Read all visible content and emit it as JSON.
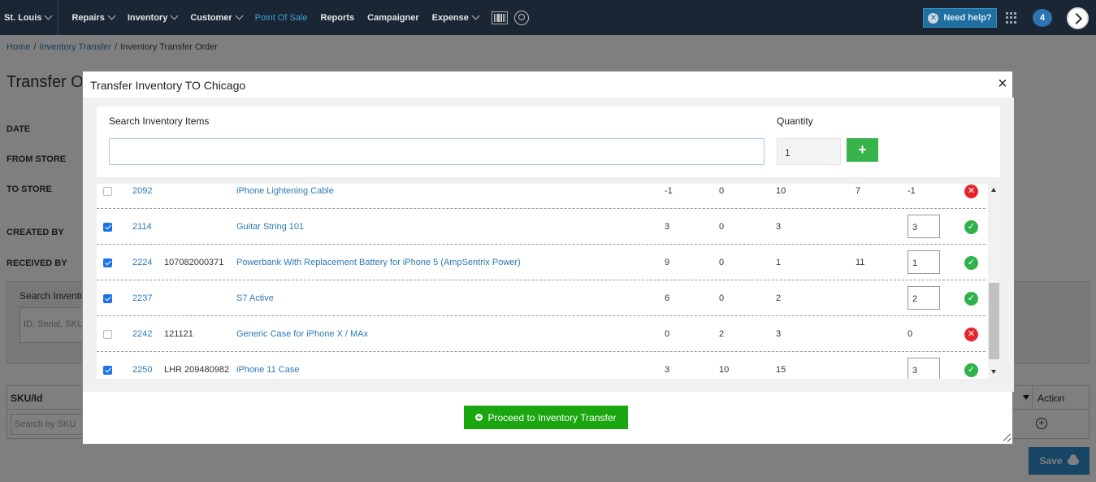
{
  "nav": {
    "items": [
      {
        "label": "St. Louis",
        "dropdown": true
      },
      {
        "label": "Repairs",
        "dropdown": true
      },
      {
        "label": "Inventory",
        "dropdown": true
      },
      {
        "label": "Customer",
        "dropdown": true
      },
      {
        "label": "Point Of Sale",
        "dropdown": false,
        "active": true
      },
      {
        "label": "Reports",
        "dropdown": false
      },
      {
        "label": "Campaigner",
        "dropdown": false
      },
      {
        "label": "Expense",
        "dropdown": true
      }
    ],
    "help_label": "Need help?",
    "notification_count": "4"
  },
  "breadcrumb": {
    "home": "Home",
    "sep": "/",
    "transfer": "Inventory Transfer",
    "current": "Inventory Transfer Order"
  },
  "page": {
    "title": "Transfer O",
    "labels": {
      "date": "DATE",
      "from_store": "FROM STORE",
      "to_store": "TO STORE",
      "created_by": "CREATED BY",
      "received_by": "RECEIVED BY"
    },
    "search_label": "Search Invento",
    "search_placeholder": "ID, Serial, SKU",
    "table": {
      "sku_header": "SKU/Id",
      "action_header": "Action",
      "sku_placeholder": "Search by SKU"
    },
    "save_label": "Save"
  },
  "modal": {
    "title": "Transfer Inventory TO Chicago",
    "close": "×",
    "search_label": "Search Inventory Items",
    "search_value": "",
    "quantity_label": "Quantity",
    "quantity_value": "1",
    "add_label": "+",
    "proceed_label": "Proceed to Inventory Transfer",
    "rows": [
      {
        "checked": false,
        "id": "2092",
        "serial": "",
        "name": "iPhone Lightening Cable",
        "n1": "-1",
        "n2": "0",
        "n3": "10",
        "n4": "7",
        "qty": "-1",
        "qty_input": false,
        "status": "bad"
      },
      {
        "checked": true,
        "id": "2114",
        "serial": "",
        "name": "Guitar String 101",
        "n1": "3",
        "n2": "0",
        "n3": "3",
        "n4": "",
        "qty": "3",
        "qty_input": true,
        "status": "ok"
      },
      {
        "checked": true,
        "id": "2224",
        "serial": "107082000371",
        "name": "Powerbank With Replacement Battery for iPhone 5 (AmpSentrix Power)",
        "n1": "9",
        "n2": "0",
        "n3": "1",
        "n4": "11",
        "qty": "1",
        "qty_input": true,
        "status": "ok"
      },
      {
        "checked": true,
        "id": "2237",
        "serial": "",
        "name": "S7 Active",
        "n1": "6",
        "n2": "0",
        "n3": "2",
        "n4": "",
        "qty": "2",
        "qty_input": true,
        "status": "ok"
      },
      {
        "checked": false,
        "id": "2242",
        "serial": "121121",
        "name": "Generic Case for iPhone X / MAx",
        "n1": "0",
        "n2": "2",
        "n3": "3",
        "n4": "",
        "qty": "0",
        "qty_input": false,
        "status": "bad"
      },
      {
        "checked": true,
        "id": "2250",
        "serial": "LHR 209480982",
        "name": "iPhone 11 Case",
        "n1": "3",
        "n2": "10",
        "n3": "15",
        "n4": "",
        "qty": "3",
        "qty_input": true,
        "status": "ok"
      }
    ]
  },
  "colors": {
    "nav_bg": "#1a2634",
    "link": "#2a7ab8",
    "success": "#19a60f",
    "error": "#e8242b"
  }
}
